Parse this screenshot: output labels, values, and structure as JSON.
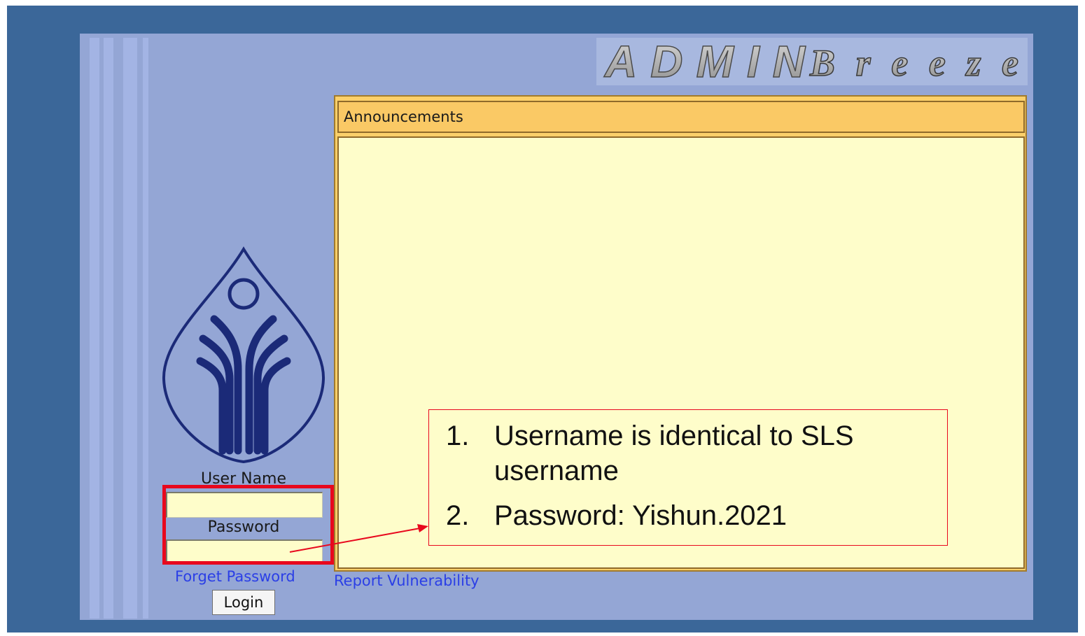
{
  "header": {
    "logo_text_admin": "ADMIN",
    "logo_text_breeze": "Breeze"
  },
  "announcements": {
    "title": "Announcements"
  },
  "login": {
    "username_label": "User Name",
    "username_value": "",
    "password_label": "Password",
    "password_value": "",
    "forget_password_link": "Forget Password",
    "login_button": "Login"
  },
  "footer": {
    "report_vulnerability_link": "Report Vulnerability"
  },
  "annotation": {
    "items": [
      {
        "number": "1.",
        "text": "Username is identical to SLS username"
      },
      {
        "number": "2.",
        "text": "Password: Yishun.2021"
      }
    ],
    "highlight_color": "#e8081d"
  },
  "colors": {
    "outer_background": "#3b6799",
    "panel_background": "#94a6d5",
    "announcement_header": "#fac965",
    "announcement_body": "#fefdca",
    "link": "#2b3fe6",
    "emblem": "#1b2a78"
  }
}
